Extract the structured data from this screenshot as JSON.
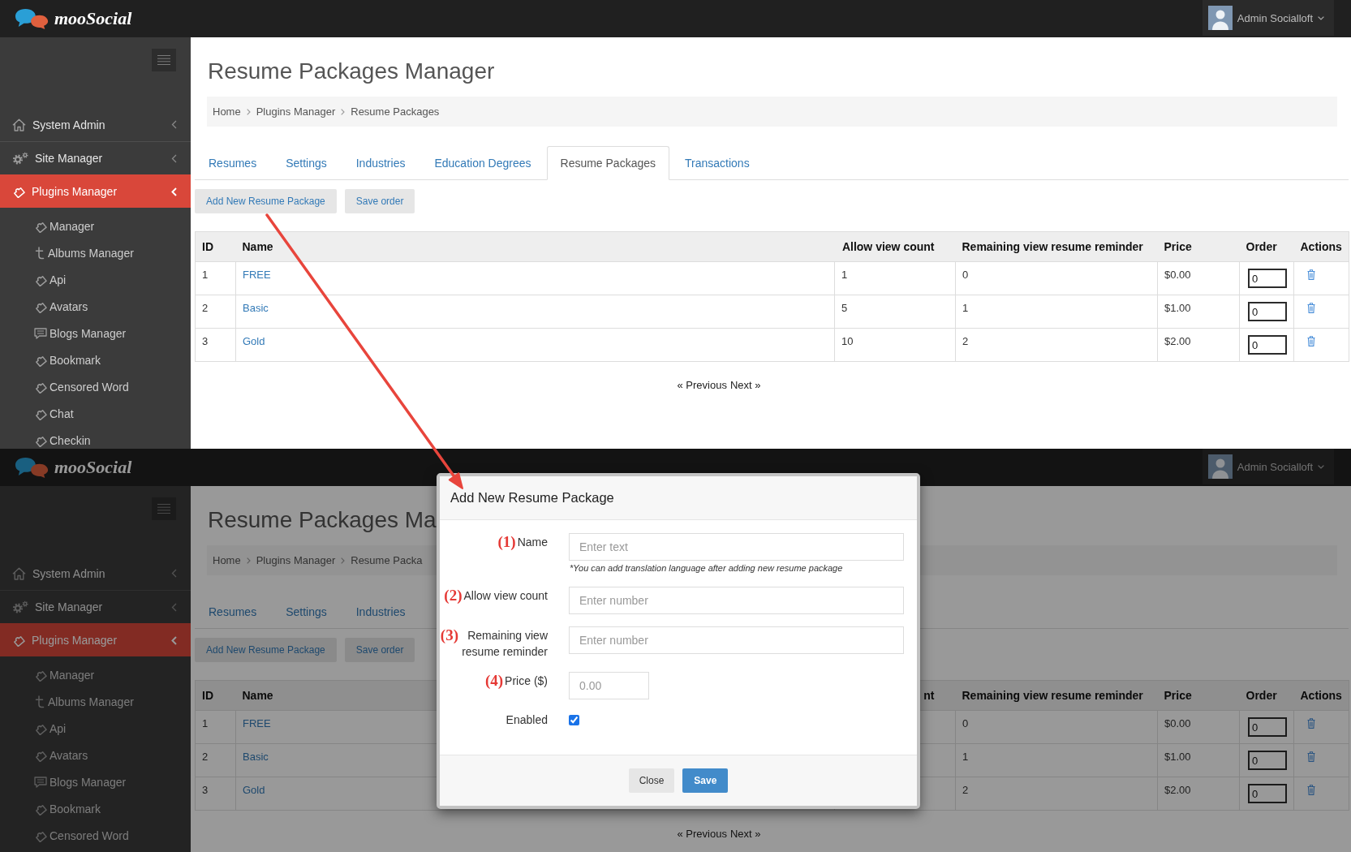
{
  "screens": [
    {
      "header": {
        "brand": "mooSocial",
        "user": "Admin Socialloft"
      },
      "sidebar": {
        "items": [
          {
            "label": "System Admin",
            "selected": false
          },
          {
            "label": "Site Manager",
            "selected": false
          },
          {
            "label": "Plugins Manager",
            "selected": true,
            "children": [
              {
                "label": "Manager",
                "selected": false
              },
              {
                "label": "Albums Manager",
                "selected": false
              },
              {
                "label": "Api",
                "selected": false
              },
              {
                "label": "Avatars",
                "selected": false
              },
              {
                "label": "Blogs Manager",
                "selected": false
              },
              {
                "label": "Bookmark",
                "selected": false
              },
              {
                "label": "Censored Word",
                "selected": false
              },
              {
                "label": "Chat",
                "selected": false
              },
              {
                "label": "Checkin",
                "selected": false
              }
            ]
          }
        ]
      },
      "page_title": "Resume Packages Manager",
      "breadcrumb": [
        "Home",
        "Plugins Manager",
        "Resume Packages"
      ],
      "tabs": [
        {
          "label": "Resumes",
          "selected": false
        },
        {
          "label": "Settings",
          "selected": false
        },
        {
          "label": "Industries",
          "selected": false
        },
        {
          "label": "Education Degrees",
          "selected": false
        },
        {
          "label": "Resume Packages",
          "selected": true
        },
        {
          "label": "Transactions",
          "selected": false
        }
      ],
      "toolbar": [
        "Add New Resume Package",
        "Save order"
      ],
      "table": {
        "columns": [
          "ID",
          "Name",
          "Allow view count",
          "Remaining view resume reminder",
          "Price",
          "Order",
          "Actions"
        ],
        "rows": [
          {
            "id": "1",
            "name": "FREE",
            "allow_view_count": "1",
            "remaining_view_resume_reminder": "0",
            "price": "$0.00",
            "order": "0"
          },
          {
            "id": "2",
            "name": "Basic",
            "allow_view_count": "5",
            "remaining_view_resume_reminder": "1",
            "price": "$1.00",
            "order": "0"
          },
          {
            "id": "3",
            "name": "Gold",
            "allow_view_count": "10",
            "remaining_view_resume_reminder": "2",
            "price": "$2.00",
            "order": "0"
          }
        ]
      },
      "pagination": {
        "previous": "« Previous",
        "next": "Next »"
      }
    },
    {
      "header": {
        "brand": "mooSocial",
        "user": "Admin Socialloft"
      },
      "sidebar": {
        "items": [
          {
            "label": "System Admin",
            "selected": false
          },
          {
            "label": "Site Manager",
            "selected": false
          },
          {
            "label": "Plugins Manager",
            "selected": true,
            "children": [
              {
                "label": "Manager",
                "selected": false
              },
              {
                "label": "Albums Manager",
                "selected": false
              },
              {
                "label": "Api",
                "selected": false
              },
              {
                "label": "Avatars",
                "selected": false
              },
              {
                "label": "Blogs Manager",
                "selected": false
              },
              {
                "label": "Bookmark",
                "selected": false
              },
              {
                "label": "Censored Word",
                "selected": false
              }
            ]
          }
        ]
      },
      "page_title": "Resume Packages Ma",
      "breadcrumb": [
        "Home",
        "Plugins Manager",
        "Resume Packa"
      ],
      "tabs": [
        {
          "label": "Resumes",
          "selected": false
        },
        {
          "label": "Settings",
          "selected": false
        },
        {
          "label": "Industries",
          "selected": false
        }
      ],
      "toolbar": [
        "Add New Resume Package",
        "Save order"
      ],
      "table": {
        "columns": [
          "ID",
          "Name",
          "nt",
          "Remaining view resume reminder",
          "Price",
          "Order",
          "Actions"
        ],
        "rows": [
          {
            "id": "1",
            "name": "FREE",
            "remaining_view_resume_reminder": "0",
            "price": "$0.00",
            "order": "0"
          },
          {
            "id": "2",
            "name": "Basic",
            "remaining_view_resume_reminder": "1",
            "price": "$1.00",
            "order": "0"
          },
          {
            "id": "3",
            "name": "Gold",
            "remaining_view_resume_reminder": "2",
            "price": "$2.00",
            "order": "0"
          }
        ]
      },
      "pagination": {
        "previous": "« Previous",
        "next": "Next »"
      },
      "modal": {
        "title": "Add New Resume Package",
        "fields": [
          {
            "kind": "text",
            "annotation": "(1)",
            "label": "Name",
            "placeholder": "Enter text",
            "help": "*You can add translation language after adding new resume package"
          },
          {
            "kind": "text",
            "annotation": "(2)",
            "label": "Allow view count",
            "placeholder": "Enter number"
          },
          {
            "kind": "text",
            "annotation": "(3)",
            "label": "Remaining view resume reminder",
            "placeholder": "Enter number"
          },
          {
            "kind": "narrow",
            "annotation": "(4)",
            "label": "Price ($)",
            "placeholder": "0.00"
          },
          {
            "kind": "checkbox",
            "label": "Enabled",
            "checked": true
          }
        ],
        "buttons": [
          {
            "label": "Close",
            "kind": "default"
          },
          {
            "label": "Save",
            "kind": "primary"
          }
        ]
      }
    }
  ]
}
